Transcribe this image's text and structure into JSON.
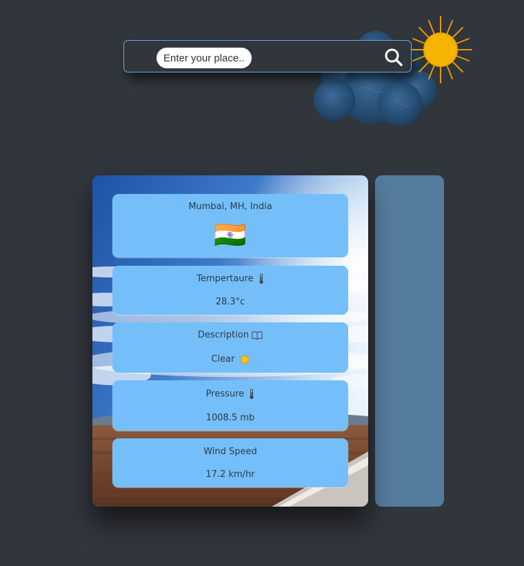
{
  "search": {
    "placeholder": "Enter your place..",
    "icon": "search-icon"
  },
  "decor": {
    "cloud_icon": "cloud-icon",
    "sun_icon": "sun-icon",
    "sun_color": "#f5b400",
    "cloud_color": "#2b4f72"
  },
  "weather": {
    "location": "Mumbai, MH, India",
    "flag": "🇮🇳",
    "temperature_label": "Tempertaure",
    "temperature_value": "28.3°c",
    "description_label": "Description",
    "description_value": "Clear",
    "pressure_label": "Pressure",
    "pressure_value": "1008.5 mb",
    "wind_label": "Wind Speed",
    "wind_value": "17.2 km/hr"
  },
  "colors": {
    "page_bg": "#31353c",
    "box_bg": "#74bffa",
    "side_panel": "#547c9e",
    "search_border": "#6fa8d8"
  }
}
